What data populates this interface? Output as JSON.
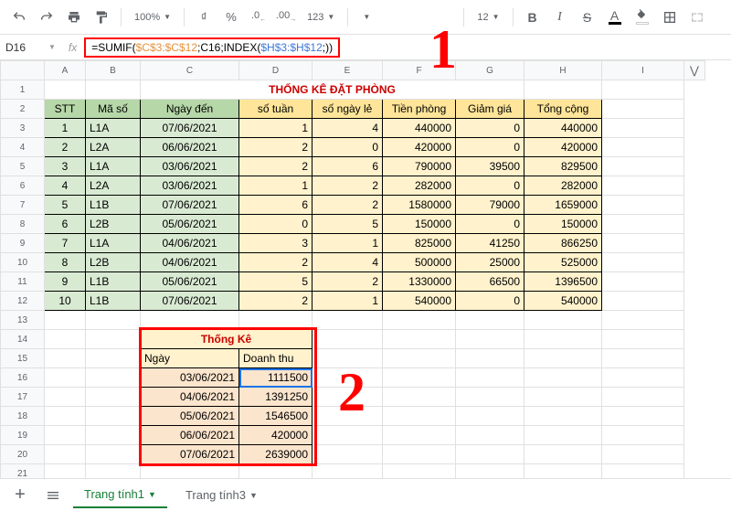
{
  "toolbar": {
    "zoom": "100%",
    "currency": "₫",
    "pct": "%",
    "dec1": ".0",
    "dec2": ".00",
    "fmt": "123",
    "font_size": "12"
  },
  "name_box": "D16",
  "formula": {
    "p1": "=SUMIF(",
    "p2": "$C$3:$C$12",
    "p3": ";C16;INDEX(",
    "p4": "$H$3:$H$12",
    "p5": ";))"
  },
  "cols": [
    "A",
    "B",
    "C",
    "D",
    "E",
    "F",
    "G",
    "H",
    "I"
  ],
  "title": "THỐNG KÊ ĐẶT PHÒNG",
  "headers": {
    "stt": "STT",
    "maso": "Mã số",
    "ngay": "Ngày đến",
    "sotuan": "số tuần",
    "songayle": "số ngày lẻ",
    "tienphong": "Tiền phòng",
    "giamgia": "Giảm giá",
    "tongcong": "Tổng cộng"
  },
  "rows": [
    {
      "n": "1",
      "m": "L1A",
      "d": "07/06/2021",
      "st": "1",
      "sn": "4",
      "tp": "440000",
      "gg": "0",
      "tc": "440000"
    },
    {
      "n": "2",
      "m": "L2A",
      "d": "06/06/2021",
      "st": "2",
      "sn": "0",
      "tp": "420000",
      "gg": "0",
      "tc": "420000"
    },
    {
      "n": "3",
      "m": "L1A",
      "d": "03/06/2021",
      "st": "2",
      "sn": "6",
      "tp": "790000",
      "gg": "39500",
      "tc": "829500"
    },
    {
      "n": "4",
      "m": "L2A",
      "d": "03/06/2021",
      "st": "1",
      "sn": "2",
      "tp": "282000",
      "gg": "0",
      "tc": "282000"
    },
    {
      "n": "5",
      "m": "L1B",
      "d": "07/06/2021",
      "st": "6",
      "sn": "2",
      "tp": "1580000",
      "gg": "79000",
      "tc": "1659000"
    },
    {
      "n": "6",
      "m": "L2B",
      "d": "05/06/2021",
      "st": "0",
      "sn": "5",
      "tp": "150000",
      "gg": "0",
      "tc": "150000"
    },
    {
      "n": "7",
      "m": "L1A",
      "d": "04/06/2021",
      "st": "3",
      "sn": "1",
      "tp": "825000",
      "gg": "41250",
      "tc": "866250"
    },
    {
      "n": "8",
      "m": "L2B",
      "d": "04/06/2021",
      "st": "2",
      "sn": "4",
      "tp": "500000",
      "gg": "25000",
      "tc": "525000"
    },
    {
      "n": "9",
      "m": "L1B",
      "d": "05/06/2021",
      "st": "5",
      "sn": "2",
      "tp": "1330000",
      "gg": "66500",
      "tc": "1396500"
    },
    {
      "n": "10",
      "m": "L1B",
      "d": "07/06/2021",
      "st": "2",
      "sn": "1",
      "tp": "540000",
      "gg": "0",
      "tc": "540000"
    }
  ],
  "tk": {
    "title": "Thống Kê",
    "h1": "Ngày",
    "h2": "Doanh thu",
    "rows": [
      {
        "d": "03/06/2021",
        "v": "1111500"
      },
      {
        "d": "04/06/2021",
        "v": "1391250"
      },
      {
        "d": "05/06/2021",
        "v": "1546500"
      },
      {
        "d": "06/06/2021",
        "v": "420000"
      },
      {
        "d": "07/06/2021",
        "v": "2639000"
      }
    ]
  },
  "tabs": {
    "t1": "Trang tính1",
    "t3": "Trang tính3"
  },
  "annot": {
    "a1": "1",
    "a2": "2"
  }
}
